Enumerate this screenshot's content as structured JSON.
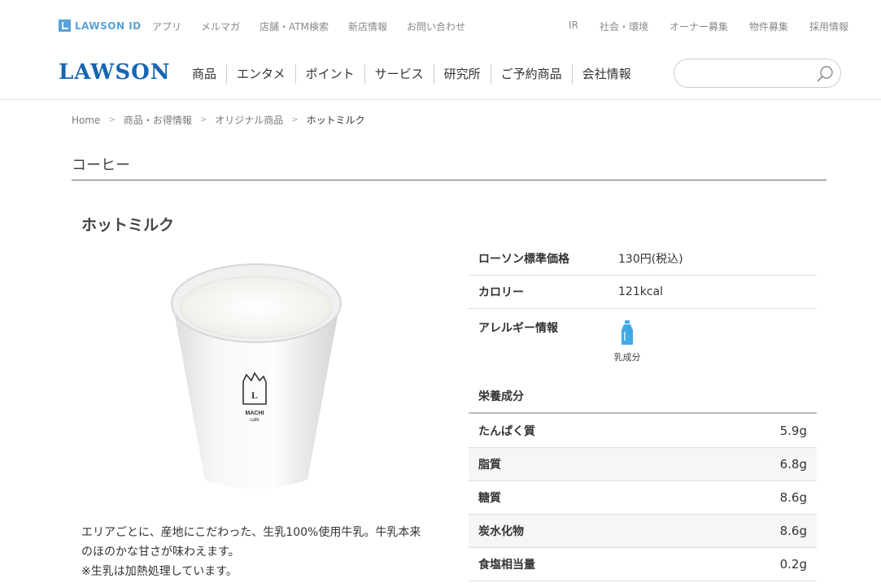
{
  "topbar": {
    "lawson_id": "LAWSON ID",
    "left_links": [
      "アプリ",
      "メルマガ",
      "店舗・ATM検索",
      "新店情報",
      "お問い合わせ"
    ],
    "right_links": [
      "IR",
      "社会・環境",
      "オーナー募集",
      "物件募集",
      "採用情報"
    ]
  },
  "header": {
    "logo": "LAWSON",
    "nav": [
      "商品",
      "エンタメ",
      "ポイント",
      "サービス",
      "研究所",
      "ご予約商品",
      "会社情報"
    ],
    "search_placeholder": ""
  },
  "breadcrumb": [
    "Home",
    "商品・お得情報",
    "オリジナル商品",
    "ホットミルク"
  ],
  "category": "コーヒー",
  "product": {
    "title": "ホットミルク",
    "cup_brand_top": "MACHI",
    "cup_brand_bottom": "café",
    "description_line1": "エリアごとに、産地にこだわった、生乳100%使用牛乳。牛乳本来のほのかな甘さが味わえます。",
    "description_line2": "※生乳は加熱処理しています。"
  },
  "info": {
    "price_label": "ローソン標準価格",
    "price_value": "130円(税込)",
    "calorie_label": "カロリー",
    "calorie_value": "121kcal",
    "allergy_label": "アレルギー情報",
    "allergy_item": "乳成分"
  },
  "nutrition": {
    "heading": "栄養成分",
    "rows": [
      {
        "label": "たんぱく質",
        "value": "5.9g"
      },
      {
        "label": "脂質",
        "value": "6.8g"
      },
      {
        "label": "糖質",
        "value": "8.6g"
      },
      {
        "label": "炭水化物",
        "value": "8.6g"
      },
      {
        "label": "食塩相当量",
        "value": "0.2g"
      }
    ]
  },
  "colors": {
    "brand_blue": "#1565b4",
    "id_blue": "#5aa2d8",
    "milk_icon": "#3fa9e8"
  }
}
